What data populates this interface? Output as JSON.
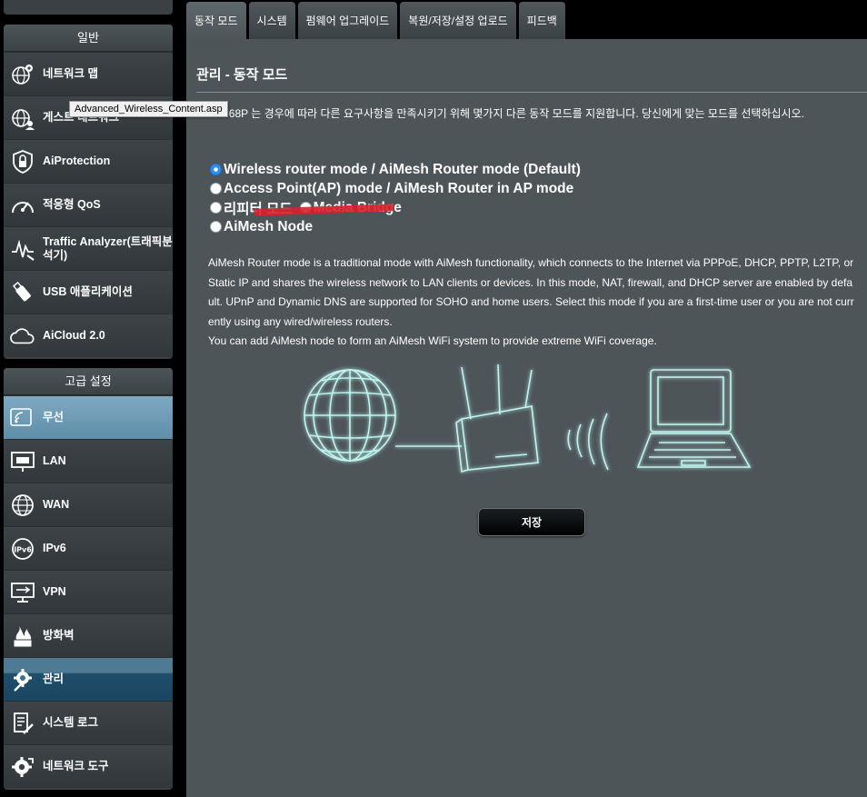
{
  "sidebar": {
    "general_title": "일반",
    "general_items": [
      {
        "label": "네트워크 맵",
        "icon": "network-map-icon"
      },
      {
        "label": "게스트 네트워크",
        "icon": "guest-network-icon"
      },
      {
        "label": "AiProtection",
        "icon": "shield-icon"
      },
      {
        "label": "적응형 QoS",
        "icon": "speedometer-icon"
      },
      {
        "label": "Traffic Analyzer(트래픽분석기)",
        "icon": "traffic-analyzer-icon"
      },
      {
        "label": "USB 애플리케이션",
        "icon": "usb-icon"
      },
      {
        "label": "AiCloud 2.0",
        "icon": "cloud-icon"
      }
    ],
    "advanced_title": "고급 설정",
    "advanced_items": [
      {
        "label": "무선",
        "icon": "wireless-icon"
      },
      {
        "label": "LAN",
        "icon": "lan-icon"
      },
      {
        "label": "WAN",
        "icon": "globe-icon"
      },
      {
        "label": "IPv6",
        "icon": "ipv6-icon"
      },
      {
        "label": "VPN",
        "icon": "vpn-icon"
      },
      {
        "label": "방화벽",
        "icon": "firewall-icon"
      },
      {
        "label": "관리",
        "icon": "gear-icon"
      },
      {
        "label": "시스템 로그",
        "icon": "system-log-icon"
      },
      {
        "label": "네트워크 도구",
        "icon": "network-tools-icon"
      }
    ]
  },
  "tabs": [
    "동작 모드",
    "시스템",
    "펌웨어 업그레이드",
    "복원/저장/설정 업로드",
    "피드백"
  ],
  "tooltip": "Advanced_Wireless_Content.asp",
  "page": {
    "title": "관리 - 동작 모드",
    "description": "RT-AC68P 는 경우에 따라 다른 요구사항을 만족시키기 위해 몇가지 다른 동작 모드를 지원합니다. 당신에게 맞는 모드를 선택하십시오."
  },
  "modes": {
    "wireless_router": "Wireless router mode / AiMesh Router mode (Default)",
    "access_point": "Access Point(AP) mode / AiMesh Router in AP mode",
    "repeater": "리피터 모드",
    "media_bridge": "Media Bridge",
    "aimesh_node": "AiMesh Node",
    "selected": "wireless_router"
  },
  "mode_description": {
    "line1": "AiMesh Router mode is a traditional mode with AiMesh functionality, which connects to the Internet via PPPoE, DHCP, PPTP, L2TP, or Static IP and shares the wireless network to LAN clients or devices. In this mode, NAT, firewall, and DHCP server are enabled by default. UPnP and Dynamic DNS are supported for SOHO and home users. Select this mode if you are a first-time user or you are not currently using any wired/wireless routers.",
    "line2": "You can add AiMesh node to form an AiMesh WiFi system to provide extreme WiFi coverage."
  },
  "save_label": "저장",
  "colors": {
    "panel_bg": "#4d5559",
    "sidebar_bg": "#3a4043",
    "active_light": "#6f9cb6",
    "active_dark": "#1e4e6b",
    "diagram_glow": "#7fe6dc",
    "selected_radio": "#2c8ff1"
  }
}
